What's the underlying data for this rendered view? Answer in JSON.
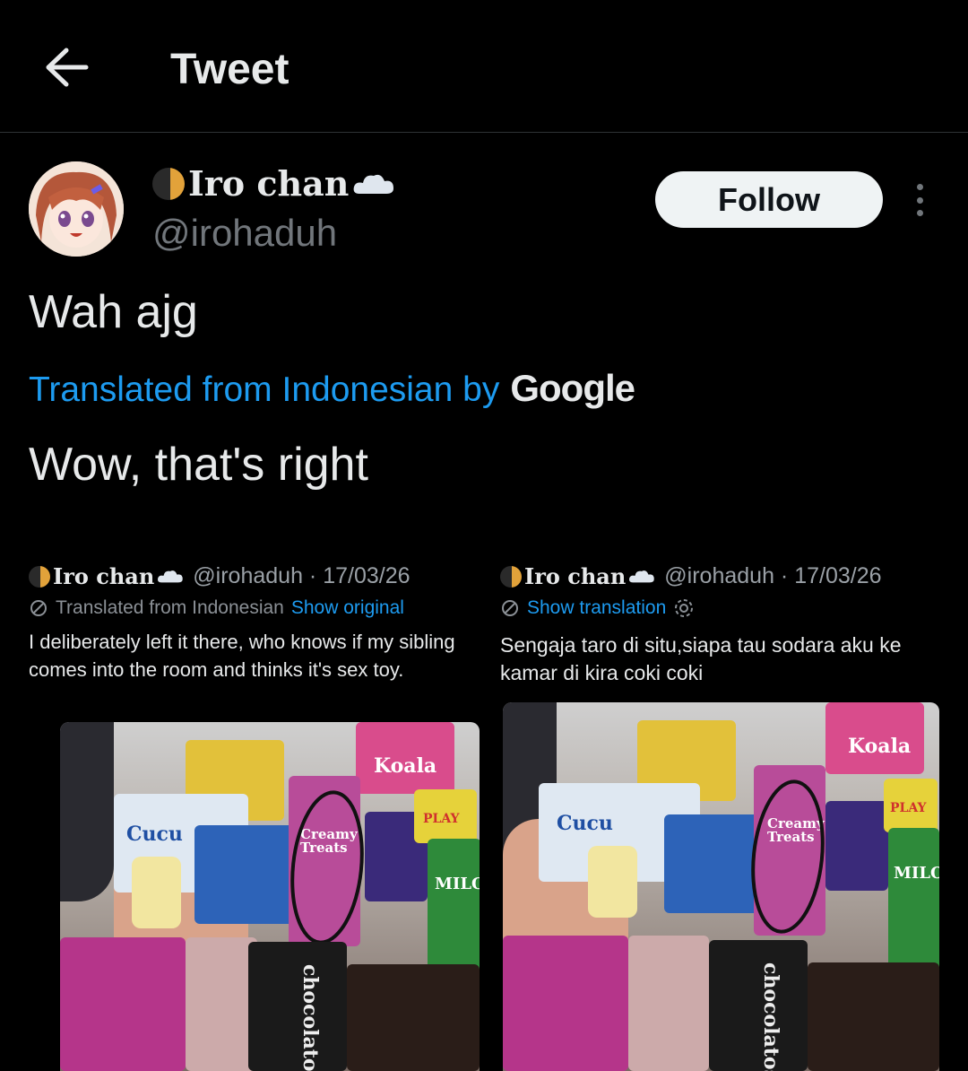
{
  "header": {
    "title": "Tweet"
  },
  "author": {
    "display_name": "Iro chan",
    "handle": "@irohaduh"
  },
  "actions": {
    "follow_label": "Follow"
  },
  "tweet": {
    "text": "Wah ajg",
    "translated_from": "Translated from Indonesian by",
    "translator": "Google",
    "translation": "Wow, that's right"
  },
  "image": {
    "left": {
      "name": "Iro chan",
      "meta": "@irohaduh · 17/03/26",
      "translated_note": "Translated from Indonesian",
      "show_original": "Show original",
      "text": "I deliberately left it there, who knows if my sibling comes into the room and thinks it's sex toy."
    },
    "right": {
      "name": "Iro chan",
      "meta": "@irohaduh · 17/03/26",
      "show_translation": "Show translation",
      "text": "Sengaja taro di situ,siapa tau sodara aku ke kamar di kira coki coki"
    },
    "photo_labels": {
      "koala": "Koala",
      "cucu": "Cucu",
      "creamy": "Creamy Treats",
      "milo": "MILO",
      "chocolatos": "chocolatos",
      "play": "PLAY"
    }
  },
  "colors": {
    "accent": "#1d9bf0",
    "background": "#000000",
    "muted": "#71767b"
  }
}
